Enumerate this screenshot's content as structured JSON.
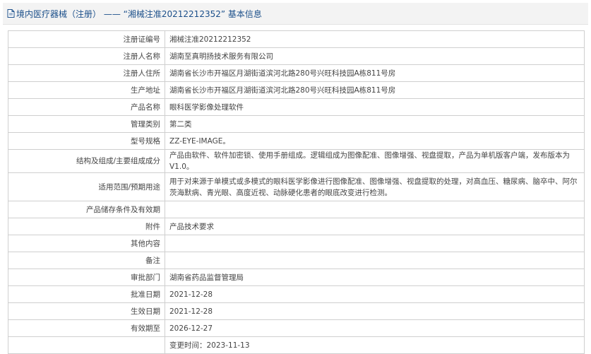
{
  "header": {
    "prefix": "境内医疗器械（注册）",
    "separator": " —— ",
    "highlight": "“湘械注准20212212352”",
    "suffix": " 基本信息",
    "icon": "document-icon"
  },
  "rows": [
    {
      "label": "注册证编号",
      "value": "湘械注准20212212352"
    },
    {
      "label": "注册人名称",
      "value": "湖南至真明扬技术服务有限公司"
    },
    {
      "label": "注册人住所",
      "value": "湖南省长沙市开福区月湖街道滨河北路280号兴旺科技园A栋811号房"
    },
    {
      "label": "生产地址",
      "value": "湖南省长沙市开福区月湖街道滨河北路280号兴旺科技园A栋811号房"
    },
    {
      "label": "产品名称",
      "value": "眼科医学影像处理软件"
    },
    {
      "label": "管理类别",
      "value": "第二类"
    },
    {
      "label": "型号规格",
      "value": "ZZ-EYE-IMAGE。"
    },
    {
      "label": "结构及组成/主要组成成分",
      "value": "产品由软件、软件加密锁、使用手册组成。逻辑组成为图像配准、图像增强、视盘提取，产品为单机版客户端，发布版本为V1.0。"
    },
    {
      "label": "适用范围/预期用途",
      "value": "用于对来源于单模式或多模式的眼科医学影像进行图像配准、图像增强、视盘提取的处理，对高血压、糖尿病、脑卒中、阿尔茨海默病、青光眼、高度近视、动脉硬化患者的眼底改变进行检测。"
    },
    {
      "label": "产品储存条件及有效期",
      "value": ""
    },
    {
      "label": "附件",
      "value": "产品技术要求"
    },
    {
      "label": "其他内容",
      "value": ""
    },
    {
      "label": "备注",
      "value": ""
    },
    {
      "label": "审批部门",
      "value": "湖南省药品监督管理局"
    },
    {
      "label": "批准日期",
      "value": "2021-12-28"
    },
    {
      "label": "生效日期",
      "value": "2021-12-28"
    },
    {
      "label": "有效期至",
      "value": "2026-12-27"
    },
    {
      "label": "",
      "value": "变更时间：2023-11-13"
    }
  ]
}
